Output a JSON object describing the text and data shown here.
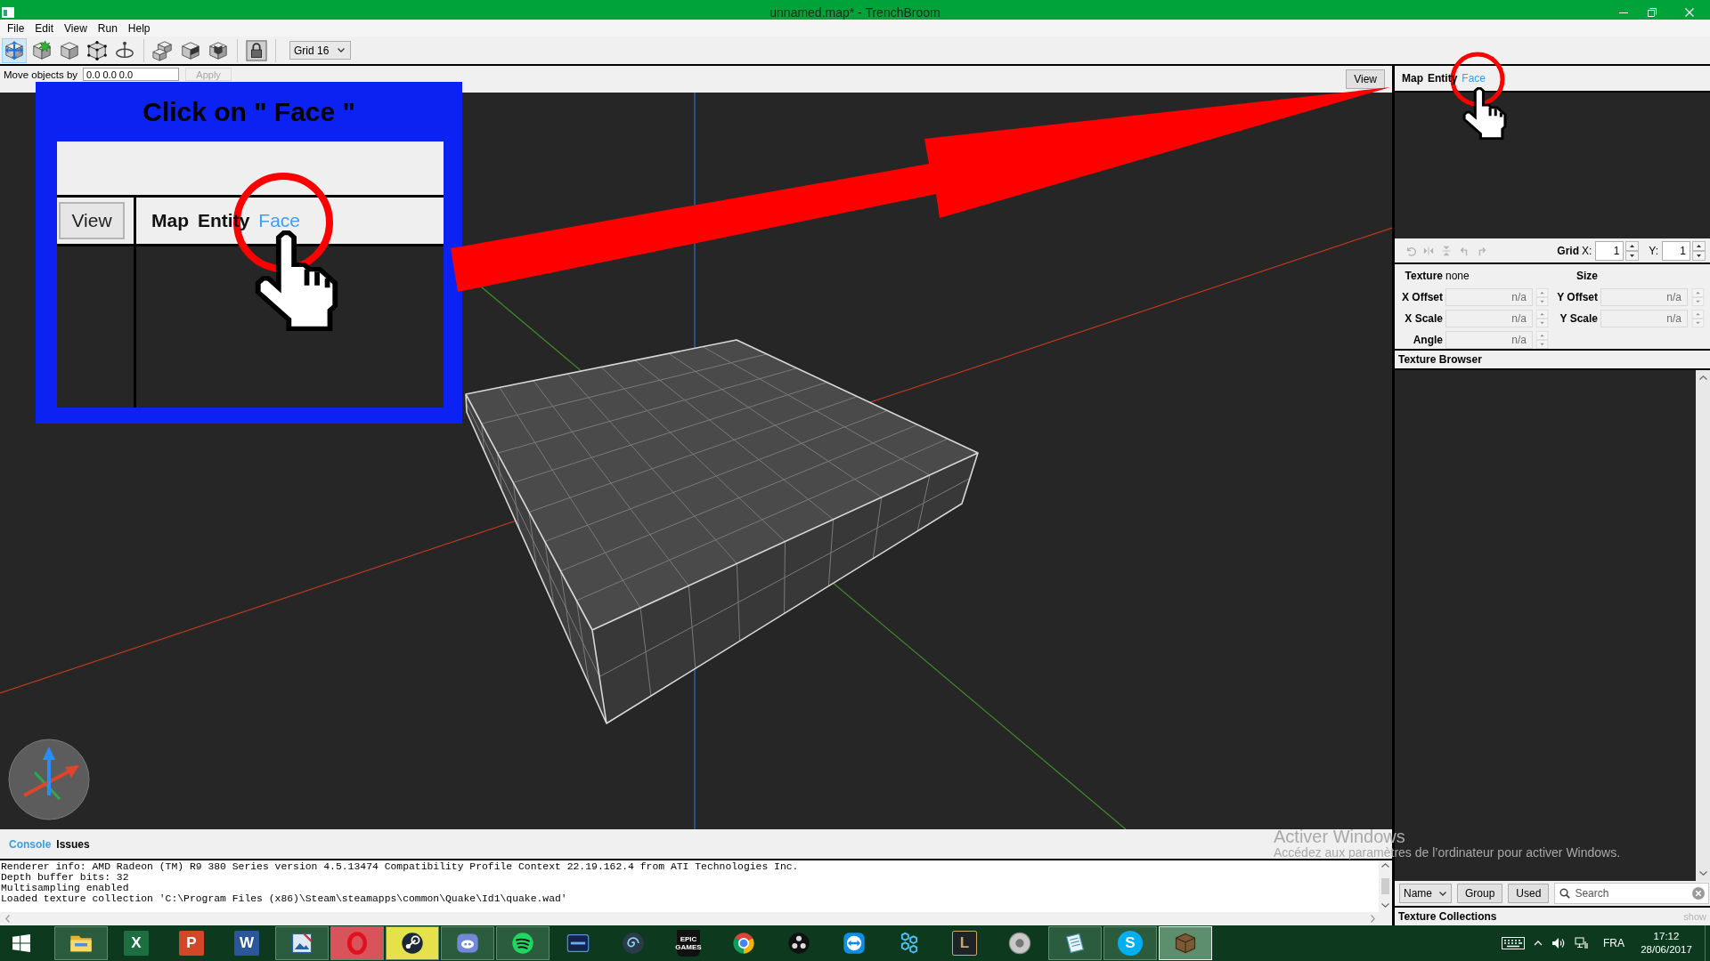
{
  "window": {
    "title": "unnamed.map* - TrenchBroom"
  },
  "menu": [
    "File",
    "Edit",
    "View",
    "Run",
    "Help"
  ],
  "toolbar": {
    "tools": [
      {
        "selected": true
      },
      {
        "selected": false
      },
      {
        "selected": false
      },
      {
        "selected": false
      },
      {
        "selected": false
      },
      {
        "selected": false
      },
      {
        "selected": false
      },
      {
        "selected": false
      }
    ],
    "grid": "Grid 16"
  },
  "move_bar": {
    "label": "Move objects by",
    "value": "0.0 0.0 0.0",
    "apply": {
      "label": "Apply",
      "disabled": true
    },
    "view_button": "View"
  },
  "inspector": {
    "tabs": [
      {
        "label": "Map",
        "selected": false
      },
      {
        "label": "Entity",
        "selected": false
      },
      {
        "label": "Face",
        "selected": true
      }
    ],
    "face_tools": [
      {
        "disabled": true
      },
      {
        "disabled": true
      },
      {
        "disabled": true
      },
      {
        "disabled": true
      },
      {
        "disabled": true
      }
    ],
    "grid_label": "Grid",
    "x_label": "X:",
    "x_value": "1",
    "y_label": "Y:",
    "y_value": "1",
    "texture_label": "Texture",
    "texture_value": "none",
    "size_label": "Size",
    "fields": [
      {
        "label": "X Offset",
        "value": "n/a",
        "disabled": true
      },
      {
        "label": "Y Offset",
        "value": "n/a",
        "disabled": true
      },
      {
        "label": "X Scale",
        "value": "n/a",
        "disabled": true
      },
      {
        "label": "Y Scale",
        "value": "n/a",
        "disabled": true
      },
      {
        "label": "Angle",
        "value": "n/a",
        "disabled": true
      }
    ]
  },
  "texture_browser": {
    "title": "Texture Browser",
    "sort": "Name",
    "filters": [
      {
        "label": "Group",
        "selected": false
      },
      {
        "label": "Used",
        "selected": false
      }
    ],
    "search": {
      "placeholder": "Search"
    },
    "collections": {
      "title": "Texture Collections",
      "toggle": "show"
    }
  },
  "console": {
    "tabs": [
      {
        "label": "Console",
        "selected": true
      },
      {
        "label": "Issues",
        "selected": false
      }
    ],
    "lines": [
      "Renderer info: AMD Radeon (TM) R9 380 Series version 4.5.13474 Compatibility Profile Context 22.19.162.4 from ATI Technologies Inc.",
      "Depth buffer bits: 32",
      "Multisampling enabled",
      "Loaded texture collection 'C:\\Program Files (x86)\\Steam\\steamapps\\common\\Quake\\Id1\\quake.wad'"
    ]
  },
  "callout": {
    "title": "Click on \" Face \"",
    "view_button": "View",
    "tabs": [
      {
        "label": "Map",
        "selected": false
      },
      {
        "label": "Entity",
        "selected": false
      },
      {
        "label": "Face",
        "selected": true
      }
    ]
  },
  "activation_notice": {
    "title": "Activer Windows",
    "message": "Accédez aux paramètres de l’ordinateur pour activer Windows."
  },
  "taskbar": {
    "apps": [
      {
        "running": true,
        "active": false
      },
      {
        "glyph": "X",
        "running": false,
        "active": false
      },
      {
        "glyph": "P",
        "running": false,
        "active": false
      },
      {
        "glyph": "W",
        "running": false,
        "active": false
      },
      {
        "running": true,
        "active": false
      },
      {
        "running": true,
        "active": false,
        "color": "#d9545a"
      },
      {
        "running": true,
        "active": false,
        "color": "#e6e04a"
      },
      {
        "running": true,
        "active": false
      },
      {
        "running": true,
        "active": false
      },
      {
        "running": false,
        "active": false
      },
      {
        "running": false,
        "active": false
      },
      {
        "glyph": "EPIC GAMES",
        "running": false,
        "active": false
      },
      {
        "running": false,
        "active": false
      },
      {
        "running": false,
        "active": false
      },
      {
        "running": false,
        "active": false
      },
      {
        "running": false,
        "active": false
      },
      {
        "glyph": "L",
        "running": false,
        "active": false
      },
      {
        "running": false,
        "active": false
      },
      {
        "running": true,
        "active": false
      },
      {
        "glyph": "S",
        "running": true,
        "active": false
      },
      {
        "running": true,
        "active": true
      }
    ],
    "language": "FRA",
    "time": "17:12",
    "date": "28/06/2017"
  }
}
